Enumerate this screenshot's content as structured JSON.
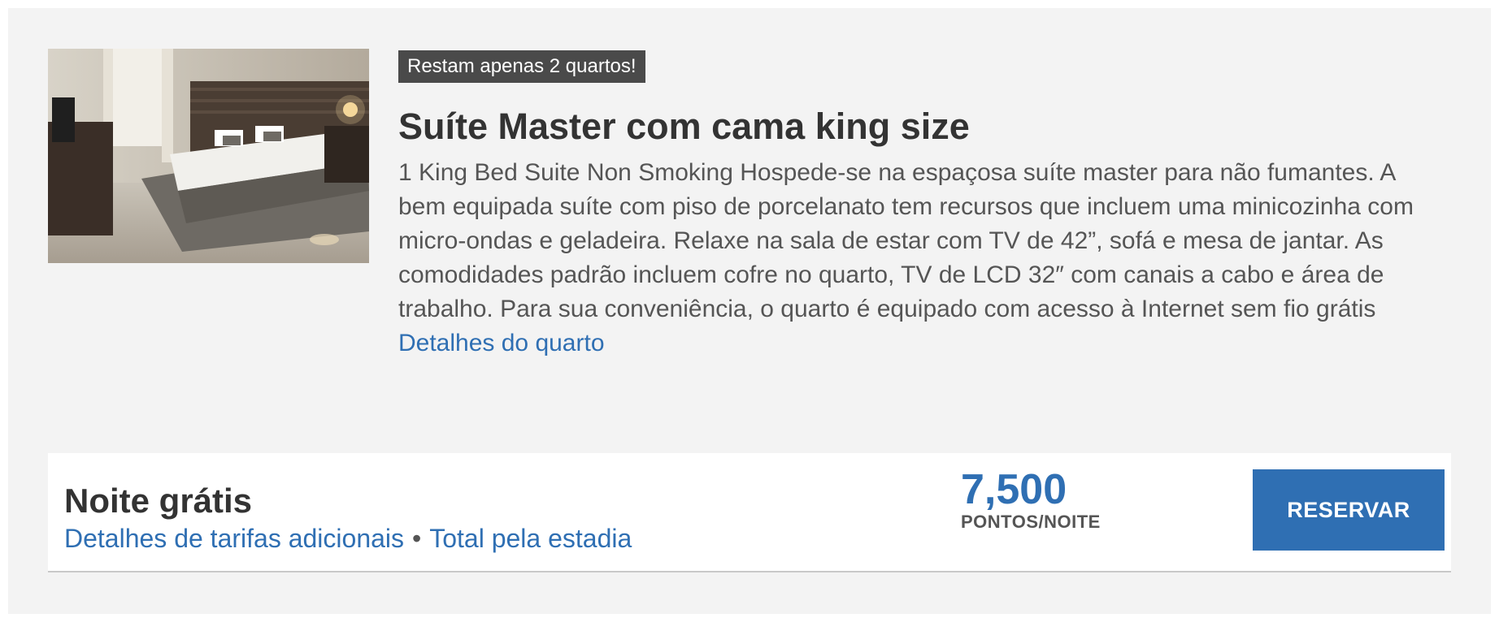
{
  "room": {
    "photo_icon": "hotel-room-photo",
    "availability_badge": "Restam apenas 2 quartos!",
    "title": "Suíte Master com cama king size",
    "description": "1 King Bed Suite Non Smoking Hospede-se na espaçosa suíte master para não fumantes. A bem equipada suíte com piso de porcelanato tem recursos que incluem uma minicozinha com micro-ondas e geladeira. Relaxe na sala de estar com TV de 42”, sofá e mesa de jantar. As comodidades padrão incluem cofre no quarto, TV de LCD 32″ com canais a cabo e área de trabalho. Para sua conveniência, o quarto é equipado com acesso à Internet sem fio grátis",
    "details_link": "Detalhes do quarto"
  },
  "rate": {
    "name": "Noite grátis",
    "additional_details_link": "Detalhes de tarifas adicionais",
    "separator": "•",
    "total_stay_link": "Total pela estadia",
    "price": "7,500",
    "price_unit": "PONTOS/NOITE",
    "book_button": "RESERVAR"
  },
  "colors": {
    "accent": "#2f6fb3",
    "card_background": "#f3f3f3",
    "badge_background": "#4a4a4a",
    "text_dark": "#333333",
    "text_body": "#555555"
  }
}
